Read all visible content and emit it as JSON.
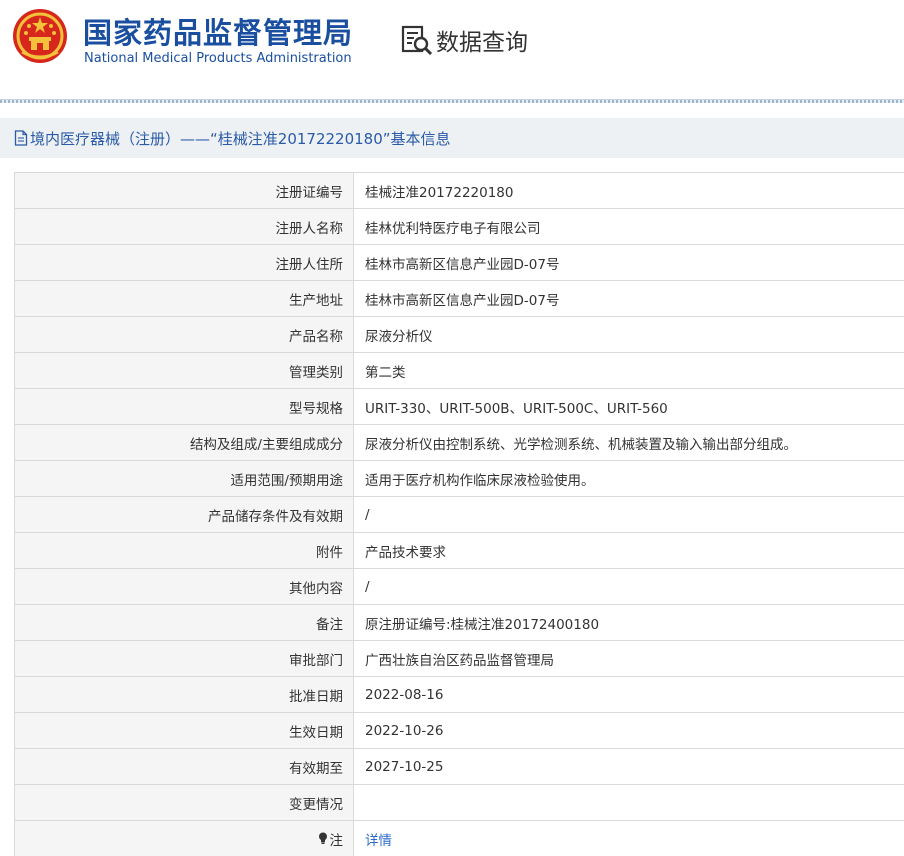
{
  "header": {
    "logo_cn": "国家药品监督管理局",
    "logo_en": "National Medical Products Administration",
    "query_label": "数据查询",
    "query_icon": "search-document-icon",
    "emblem_icon": "national-emblem-icon"
  },
  "colors": {
    "brand_blue": "#1a4fa0",
    "title_blue": "#2a5aa8",
    "link_blue": "#2a6acb",
    "label_bg": "#f5f5f5",
    "titlebar_bg": "#eef1f4"
  },
  "titlebar": {
    "icon": "document-icon",
    "text": "境内医疗器械（注册）——“桂械注准20172220180”基本信息"
  },
  "rows": [
    {
      "label": "注册证编号",
      "value": "桂械注准20172220180"
    },
    {
      "label": "注册人名称",
      "value": "桂林优利特医疗电子有限公司"
    },
    {
      "label": "注册人住所",
      "value": "桂林市高新区信息产业园D-07号"
    },
    {
      "label": "生产地址",
      "value": "桂林市高新区信息产业园D-07号"
    },
    {
      "label": "产品名称",
      "value": "尿液分析仪"
    },
    {
      "label": "管理类别",
      "value": "第二类"
    },
    {
      "label": "型号规格",
      "value": "URIT-330、URIT-500B、URIT-500C、URIT-560"
    },
    {
      "label": "结构及组成/主要组成成分",
      "value": "尿液分析仪由控制系统、光学检测系统、机械装置及输入输出部分组成。"
    },
    {
      "label": "适用范围/预期用途",
      "value": "适用于医疗机构作临床尿液检验使用。"
    },
    {
      "label": "产品储存条件及有效期",
      "value": "/"
    },
    {
      "label": "附件",
      "value": "产品技术要求"
    },
    {
      "label": "其他内容",
      "value": "/"
    },
    {
      "label": "备注",
      "value": "原注册证编号:桂械注准20172400180"
    },
    {
      "label": "审批部门",
      "value": "广西壮族自治区药品监督管理局"
    },
    {
      "label": "批准日期",
      "value": "2022-08-16"
    },
    {
      "label": "生效日期",
      "value": "2022-10-26"
    },
    {
      "label": "有效期至",
      "value": "2027-10-25"
    },
    {
      "label": "变更情况",
      "value": ""
    }
  ],
  "note_row": {
    "label": "注",
    "icon": "lightbulb-icon",
    "link_text": "详情"
  }
}
